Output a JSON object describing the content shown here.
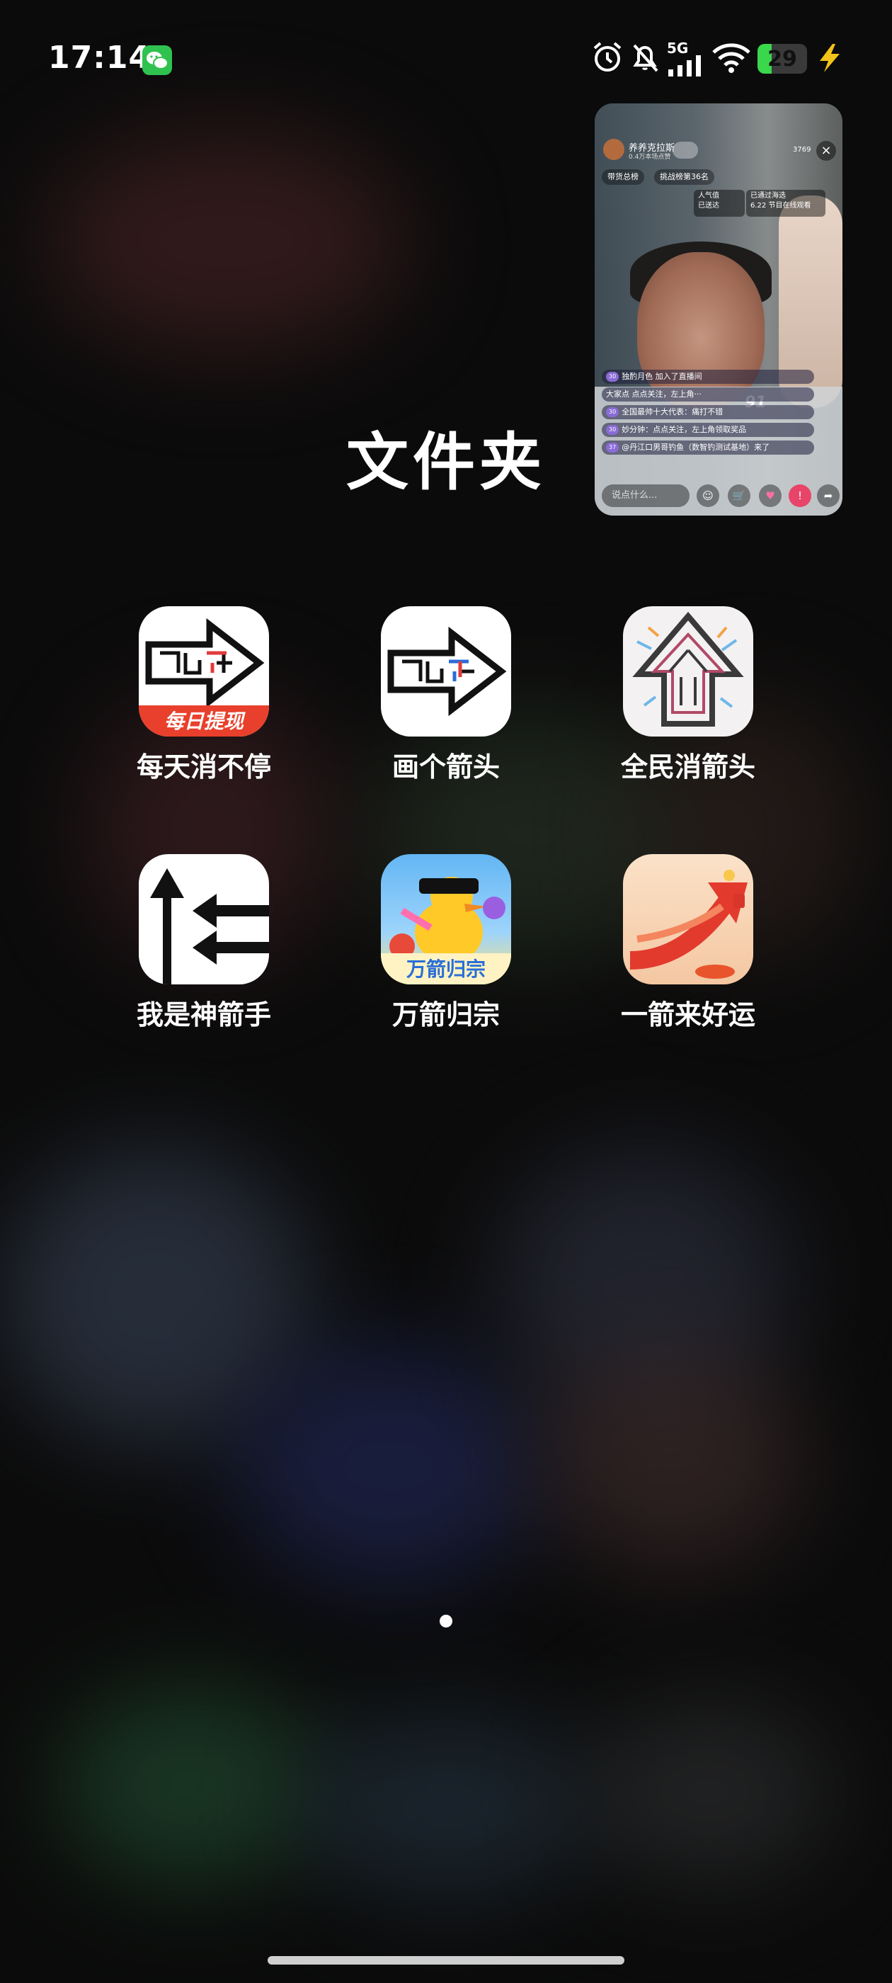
{
  "status_bar": {
    "time": "17:14",
    "network": "5G",
    "battery": 29,
    "battery_color": "#3ad64c"
  },
  "pip": {
    "streamer_name": "养养克拉斯",
    "streamer_sub": "0.4万本场点赞",
    "viewer_count": "3769",
    "chips": [
      "带货总榜",
      "挑战榜第36名"
    ],
    "box_left_line1": "人气值",
    "box_left_line2": "已送达",
    "box_right_line1": "已通过海选",
    "box_right_line2": "6.22 节目在线观看",
    "score": "91",
    "comments": [
      {
        "level": "30",
        "text": "独酌月色 加入了直播间"
      },
      {
        "level": "",
        "text": "大家点 点点关注，左上角···"
      },
      {
        "level": "30",
        "text": "全国最帅十大代表：痛打不错"
      },
      {
        "level": "30",
        "text": "妙分钟：点点关注，左上角领取奖品"
      },
      {
        "level": "37",
        "text": "@丹江口男哥钓鱼（数智钓测试基地）来了"
      }
    ],
    "input_placeholder": "说点什么..."
  },
  "folder": {
    "title": "文件夹",
    "apps": [
      {
        "label": "每天消不停",
        "icon": "maze-arrow-daily-cash-icon"
      },
      {
        "label": "画个箭头",
        "icon": "maze-arrow-icon"
      },
      {
        "label": "全民消箭头",
        "icon": "colorful-up-arrow-icon"
      },
      {
        "label": "我是神箭手",
        "icon": "arrows-black-icon"
      },
      {
        "label": "万箭归宗",
        "icon": "cartoon-duck-icon"
      },
      {
        "label": "一箭来好运",
        "icon": "red-lucky-arrow-icon"
      }
    ],
    "app0_badge": "每日提现",
    "app4_badge": "万箭归宗"
  }
}
